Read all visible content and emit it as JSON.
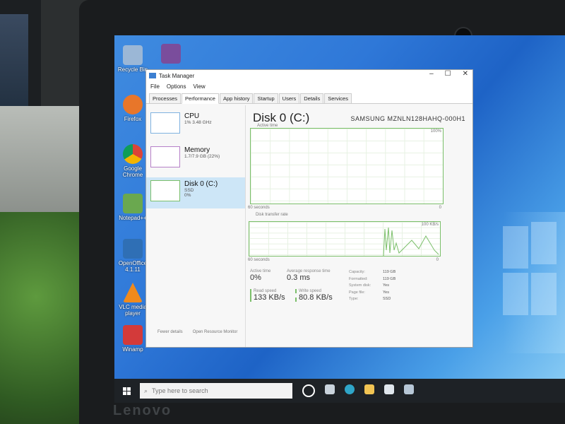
{
  "desktop": {
    "icons": [
      {
        "label": "Recycle Bin",
        "color": "#9bb7d6"
      },
      {
        "label": "",
        "color": "#7a4d9c"
      },
      {
        "label": "Firefox",
        "color": "#e8762a"
      },
      {
        "label": "Google Chrome",
        "color": "#db4437"
      },
      {
        "label": "Notepad++",
        "color": "#6aa84f"
      },
      {
        "label": "OpenOffice 4.1.11",
        "color": "#2f6fb5"
      },
      {
        "label": "VLC media player",
        "color": "#f08a1c"
      },
      {
        "label": "Winamp",
        "color": "#d33a3a"
      }
    ]
  },
  "window": {
    "title": "Task Manager",
    "controls": {
      "minimize": "–",
      "maximize": "☐",
      "close": "✕"
    }
  },
  "menu": [
    "File",
    "Options",
    "View"
  ],
  "tabs": [
    "Processes",
    "Performance",
    "App history",
    "Startup",
    "Users",
    "Details",
    "Services"
  ],
  "active_tab": "Performance",
  "sidebar": [
    {
      "name": "CPU",
      "sub": "1% 3.48 GHz"
    },
    {
      "name": "Memory",
      "sub": "1.7/7.9 GB (22%)"
    },
    {
      "name": "Disk 0 (C:)",
      "sub": "SSD",
      "sub2": "0%"
    }
  ],
  "disk": {
    "title": "Disk 0 (C:)",
    "model": "SAMSUNG MZNLN128HAHQ-000H1",
    "graph1": {
      "label": "Active time",
      "max": "100%",
      "time": "60 seconds",
      "min": "0"
    },
    "graph2": {
      "label": "Disk transfer rate",
      "max": "100 KB/s",
      "time": "60 seconds",
      "min": "0"
    },
    "stats": {
      "active_time": {
        "label": "Active time",
        "value": "0%"
      },
      "response": {
        "label": "Average response time",
        "value": "0.3 ms"
      },
      "read": {
        "label": "Read speed",
        "value": "133 KB/s"
      },
      "write": {
        "label": "Write speed",
        "value": "80.8 KB/s"
      }
    },
    "props": [
      {
        "k": "Capacity:",
        "v": "119 GB"
      },
      {
        "k": "Formatted:",
        "v": "119 GB"
      },
      {
        "k": "System disk:",
        "v": "Yes"
      },
      {
        "k": "Page file:",
        "v": "Yes"
      },
      {
        "k": "Type:",
        "v": "SSD"
      }
    ]
  },
  "footer": {
    "fewer": "Fewer details",
    "monitor": "Open Resource Monitor"
  },
  "taskbar": {
    "search_placeholder": "Type here to search"
  },
  "brand": "Lenovo"
}
